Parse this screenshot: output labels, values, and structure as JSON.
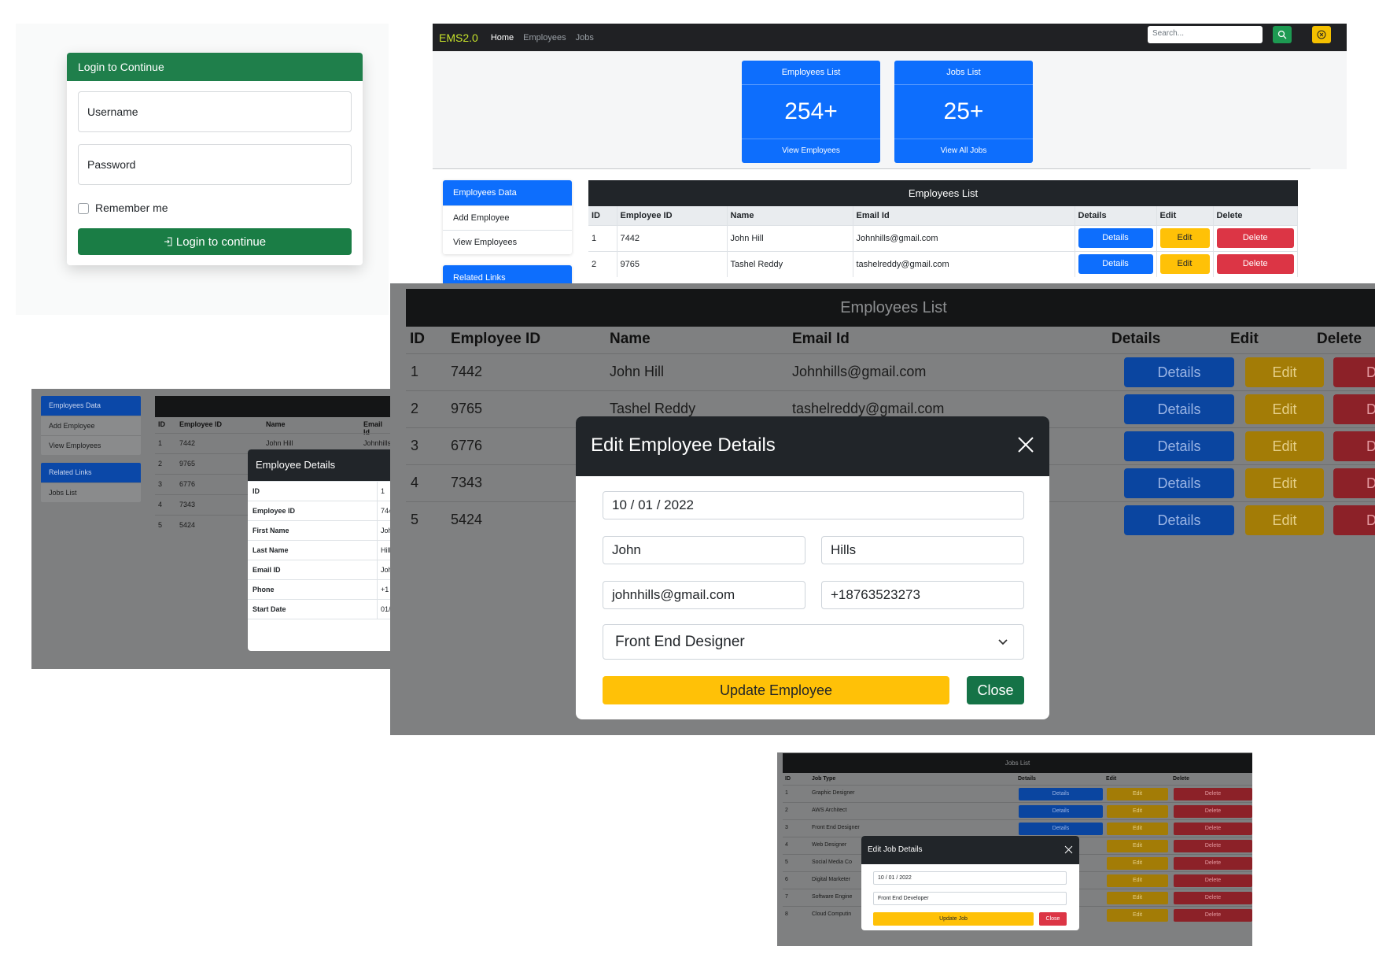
{
  "login": {
    "title": "Login to Continue",
    "username_placeholder": "Username",
    "password_placeholder": "Password",
    "remember_label": "Remember me",
    "submit_label": "Login to continue"
  },
  "navbar": {
    "brand": "EMS2.0",
    "links": [
      "Home",
      "Employees",
      "Jobs"
    ],
    "search_placeholder": "Search..."
  },
  "stats": [
    {
      "title": "Employees List",
      "value": "254+",
      "link": "View Employees"
    },
    {
      "title": "Jobs List",
      "value": "25+",
      "link": "View All Jobs"
    }
  ],
  "sidebar": {
    "employees_title": "Employees Data",
    "employees_items": [
      "Add Employee",
      "View Employees"
    ],
    "related_title": "Related Links",
    "related_items": [
      "Jobs List"
    ]
  },
  "employees_table": {
    "title": "Employees List",
    "columns": [
      "ID",
      "Employee ID",
      "Name",
      "Email Id",
      "Details",
      "Edit",
      "Delete"
    ],
    "rows": [
      {
        "id": "1",
        "emp_id": "7442",
        "name": "John Hill",
        "email": "Johnhills@gmail.com"
      },
      {
        "id": "2",
        "emp_id": "9765",
        "name": "Tashel Reddy",
        "email": "tashelreddy@gmail.com"
      },
      {
        "id": "3",
        "emp_id": "6776",
        "name": "",
        "email": ""
      },
      {
        "id": "4",
        "emp_id": "7343",
        "name": "",
        "email": ""
      },
      {
        "id": "5",
        "emp_id": "5424",
        "name": "",
        "email": ""
      }
    ],
    "details_label": "Details",
    "edit_label": "Edit",
    "delete_label": "Delete",
    "small_email_header": "Email Id",
    "small_email_cut": "Johnhills",
    "big_delete_cut": "Dele",
    "big_delete_header_cut": "Delete"
  },
  "employee_details": {
    "title": "Employee Details",
    "fields": [
      {
        "label": "ID",
        "value": "1"
      },
      {
        "label": "Employee ID",
        "value": "744"
      },
      {
        "label": "First Name",
        "value": "Joh"
      },
      {
        "label": "Last Name",
        "value": "Hill"
      },
      {
        "label": "Email ID",
        "value": "Joh"
      },
      {
        "label": "Phone",
        "value": "+1"
      },
      {
        "label": "Start Date",
        "value": "01/"
      }
    ]
  },
  "edit_employee": {
    "title": "Edit Employee Details",
    "date": "10 / 01 / 2022",
    "first_name": "John",
    "last_name": "Hills",
    "email": "johnhills@gmail.com",
    "phone": "+18763523273",
    "job": "Front End Designer",
    "update_label": "Update Employee",
    "close_label": "Close"
  },
  "jobs_table": {
    "title": "Jobs List",
    "columns": [
      "ID",
      "Job Type",
      "Details",
      "Edit",
      "Delete"
    ],
    "rows": [
      {
        "id": "1",
        "type": "Graphic Designer"
      },
      {
        "id": "2",
        "type": "AWS Architect"
      },
      {
        "id": "3",
        "type": "Front End Designer"
      },
      {
        "id": "4",
        "type": "Web Designer"
      },
      {
        "id": "5",
        "type": "Social Media Co"
      },
      {
        "id": "6",
        "type": "Digital Marketer"
      },
      {
        "id": "7",
        "type": "Software Engine"
      },
      {
        "id": "8",
        "type": "Cloud Computin"
      }
    ]
  },
  "edit_job": {
    "title": "Edit Job Details",
    "date": "10 / 01 / 2022",
    "job": "Front End Developer",
    "update_label": "Update Job",
    "close_label": "Close"
  },
  "colors": {
    "success": "#1f7f4b",
    "primary": "#0d6efd",
    "warning": "#ffc107",
    "danger": "#dc3545",
    "dark": "#212529",
    "brand": "#c6e12a"
  }
}
